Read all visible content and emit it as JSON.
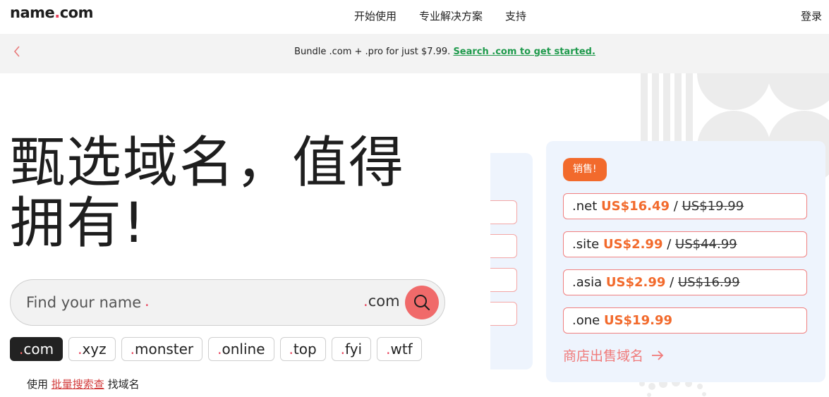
{
  "header": {
    "logo_main": "name",
    "logo_dot": ".",
    "logo_tld": "com",
    "nav": [
      "开始使用",
      "专业解决方案",
      "支持"
    ],
    "login": "登录"
  },
  "banner": {
    "text": "Bundle .com + .pro for just $7.99.",
    "link": "Search .com to get started."
  },
  "hero": {
    "title_line1": "甄选域名，值得",
    "title_line2": "拥有!"
  },
  "search": {
    "placeholder": "Find your name",
    "placeholder_dot": ".",
    "tld_dot": ".",
    "tld": "com"
  },
  "tld_chips": [
    {
      "dot": ".",
      "label": "com",
      "active": true
    },
    {
      "dot": ".",
      "label": "xyz",
      "active": false
    },
    {
      "dot": ".",
      "label": "monster",
      "active": false
    },
    {
      "dot": ".",
      "label": "online",
      "active": false
    },
    {
      "dot": ".",
      "label": "top",
      "active": false
    },
    {
      "dot": ".",
      "label": "fyi",
      "active": false
    },
    {
      "dot": ".",
      "label": "wtf",
      "active": false
    }
  ],
  "bulk": {
    "prefix": "使用",
    "link": "批量搜索查",
    "suffix": "找域名"
  },
  "sale": {
    "badge": "销售!",
    "items": [
      {
        "tld": ".net",
        "price": "US$16.49",
        "sep": "/",
        "old": "US$19.99"
      },
      {
        "tld": ".site",
        "price": "US$2.99",
        "sep": "/",
        "old": "US$44.99"
      },
      {
        "tld": ".asia",
        "price": "US$2.99",
        "sep": "/",
        "old": "US$16.99"
      },
      {
        "tld": ".one",
        "price": "US$19.99",
        "sep": "",
        "old": ""
      }
    ],
    "shop_link": "商店出售域名"
  },
  "colors": {
    "accent_red": "#e8405a",
    "sale_orange": "#f26a2c",
    "link_green": "#1f9a4c",
    "card_bg": "#eef4fd"
  },
  "icons": [
    "chevron-left-icon",
    "search-icon",
    "arrow-right-icon"
  ]
}
